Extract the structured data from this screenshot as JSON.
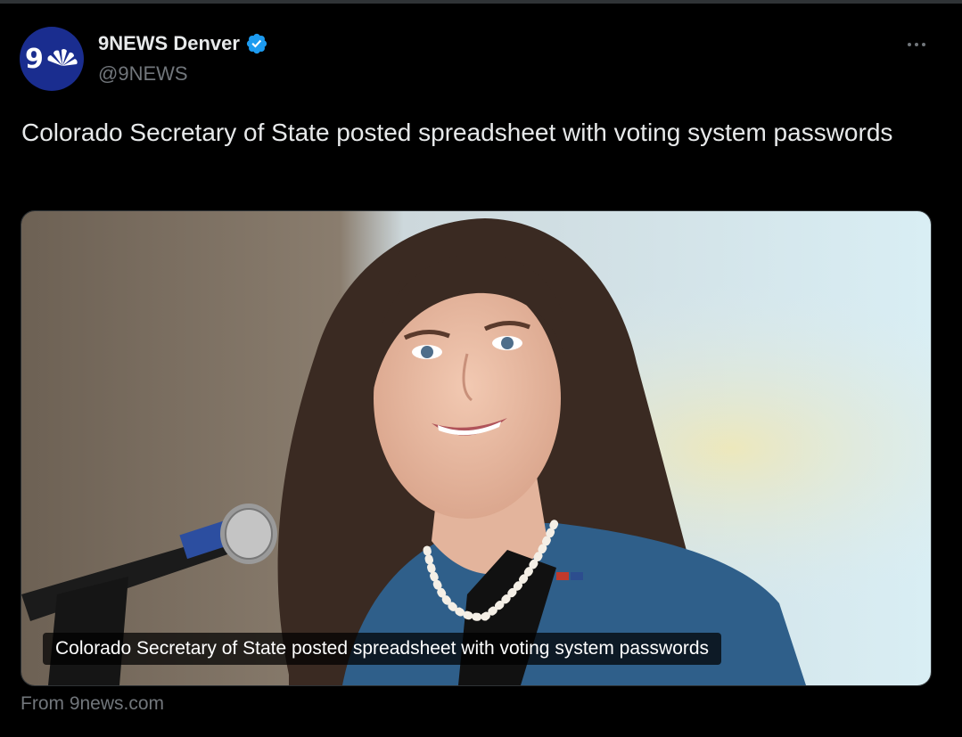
{
  "account": {
    "display_name": "9NEWS Denver",
    "handle": "@9NEWS",
    "avatar_text": "9",
    "verified": true
  },
  "tweet": {
    "text": "Colorado Secretary of State posted spreadsheet with voting system passwords"
  },
  "card": {
    "headline": "Colorado Secretary of State posted spreadsheet with voting system passwords",
    "source": "From 9news.com"
  },
  "icons": {
    "verified": "verified-badge-icon",
    "more": "more-options-icon",
    "avatar_logo": "nbc-peacock-icon"
  },
  "colors": {
    "background": "#000000",
    "text_primary": "#e7e9ea",
    "text_secondary": "#71767b",
    "verified_blue": "#1d9bf0",
    "avatar_blue": "#1a2d8f"
  }
}
